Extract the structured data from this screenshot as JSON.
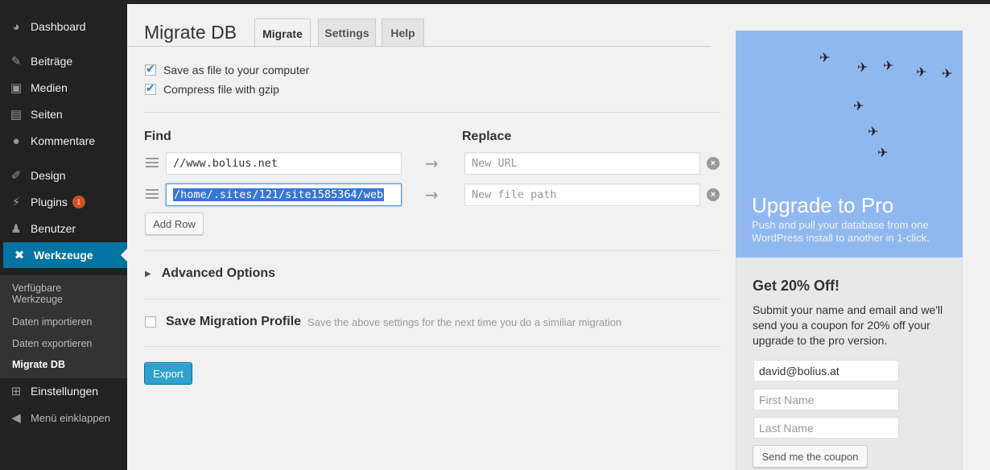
{
  "sidebar": {
    "items": [
      {
        "label": "Dashboard",
        "icon": "dashboard-icon"
      },
      {
        "label": "Beiträge",
        "icon": "pin-icon"
      },
      {
        "label": "Medien",
        "icon": "media-icon"
      },
      {
        "label": "Seiten",
        "icon": "pages-icon"
      },
      {
        "label": "Kommentare",
        "icon": "comment-icon"
      },
      {
        "label": "Design",
        "icon": "brush-icon"
      },
      {
        "label": "Plugins",
        "icon": "plug-icon",
        "badge": "1"
      },
      {
        "label": "Benutzer",
        "icon": "user-icon"
      },
      {
        "label": "Werkzeuge",
        "icon": "wrench-icon"
      },
      {
        "label": "Einstellungen",
        "icon": "settings-icon"
      },
      {
        "label": "Menü einklappen",
        "icon": "collapse-icon"
      }
    ],
    "submenu": [
      "Verfügbare Werkzeuge",
      "Daten importieren",
      "Daten exportieren",
      "Migrate DB"
    ]
  },
  "header": {
    "title": "Migrate DB",
    "tabs": [
      "Migrate",
      "Settings",
      "Help"
    ]
  },
  "options": {
    "save_file": "Save as file to your computer",
    "compress": "Compress file with gzip"
  },
  "find_replace": {
    "find_label": "Find",
    "replace_label": "Replace",
    "rows": [
      {
        "find": "//www.bolius.net",
        "replace_placeholder": "New URL"
      },
      {
        "find": "/home/.sites/121/site1585364/web",
        "replace_placeholder": "New file path"
      }
    ],
    "add_row": "Add Row"
  },
  "advanced": "Advanced Options",
  "profile": {
    "label": "Save Migration Profile",
    "hint": "Save the above settings for the next time you do a similiar migration"
  },
  "export": "Export",
  "promo": {
    "title": "Upgrade to Pro",
    "text": "Push and pull your database from one WordPress install to another in 1-click."
  },
  "coupon": {
    "title": "Get 20% Off!",
    "text": "Submit your name and email and we'll send you a coupon for 20% off your upgrade to the pro version.",
    "email": "david@bolius.at",
    "first_name_placeholder": "First Name",
    "last_name_placeholder": "Last Name",
    "button": "Send me the coupon"
  },
  "colors": {
    "sidebar_bg": "#222222",
    "accent": "#0074a2",
    "promo_bg": "#8fb8ee",
    "badge": "#d54e21"
  }
}
